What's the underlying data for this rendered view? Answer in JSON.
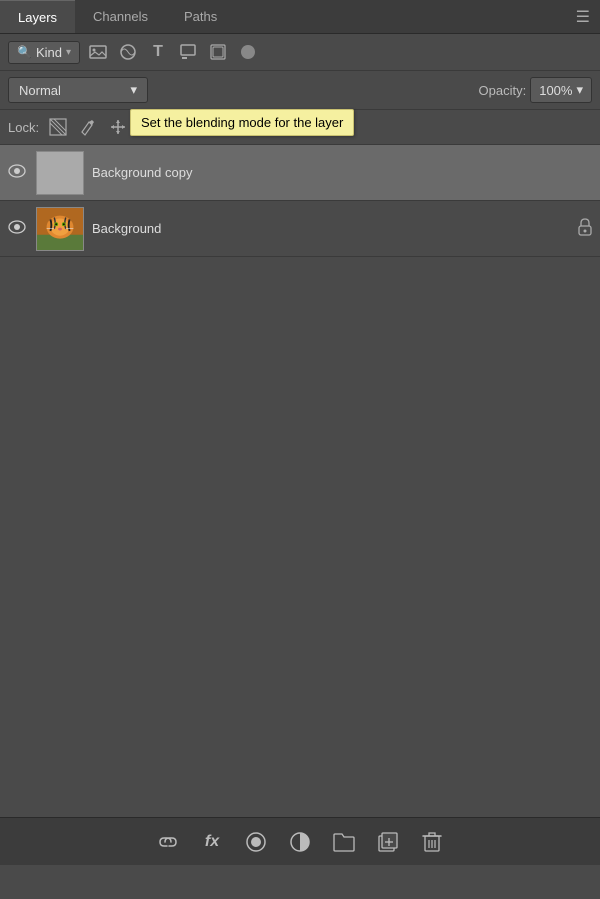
{
  "tabs": [
    {
      "id": "layers",
      "label": "Layers",
      "active": true
    },
    {
      "id": "channels",
      "label": "Channels",
      "active": false
    },
    {
      "id": "paths",
      "label": "Paths",
      "active": false
    }
  ],
  "filter": {
    "kind_label": "Kind",
    "icons": [
      {
        "name": "image-icon",
        "symbol": "🖼",
        "active": false
      },
      {
        "name": "circle-icon",
        "symbol": "◑",
        "active": false
      },
      {
        "name": "type-icon",
        "symbol": "T",
        "active": false
      },
      {
        "name": "crop-icon",
        "symbol": "⌗",
        "active": false
      },
      {
        "name": "stamp-icon",
        "symbol": "⬡",
        "active": false
      },
      {
        "name": "circle-dot-icon",
        "symbol": "⬤",
        "active": false
      }
    ]
  },
  "blend": {
    "mode": "Normal",
    "mode_arrow": "▾",
    "opacity_label": "Opacity:",
    "opacity_value": "100%",
    "opacity_arrow": "▾"
  },
  "tooltip": {
    "text": "Set the blending mode for the layer"
  },
  "lock": {
    "label": "Lock:",
    "icons": [
      {
        "name": "lock-pixels-icon",
        "symbol": "⬚"
      },
      {
        "name": "lock-paint-icon",
        "symbol": "✏"
      },
      {
        "name": "lock-move-icon",
        "symbol": "✛"
      },
      {
        "name": "lock-artboard-icon",
        "symbol": "⬜"
      }
    ]
  },
  "layers": [
    {
      "id": "background-copy",
      "name": "Background copy",
      "visible": true,
      "selected": true,
      "thumb_type": "grey",
      "locked": false
    },
    {
      "id": "background",
      "name": "Background",
      "visible": true,
      "selected": false,
      "thumb_type": "tiger",
      "locked": true
    }
  ],
  "bottom_toolbar": {
    "icons": [
      {
        "name": "link-icon",
        "symbol": "⛓"
      },
      {
        "name": "fx-icon",
        "symbol": "fx"
      },
      {
        "name": "mask-icon",
        "symbol": "◎"
      },
      {
        "name": "adjustment-icon",
        "symbol": "◑"
      },
      {
        "name": "folder-icon",
        "symbol": "▭"
      },
      {
        "name": "new-layer-icon",
        "symbol": "⬜"
      },
      {
        "name": "delete-icon",
        "symbol": "🗑"
      }
    ]
  },
  "colors": {
    "bg": "#4a4a4a",
    "tab_bar": "#3c3c3c",
    "selected_layer": "#6a6a6a",
    "tooltip_bg": "#f5f0a0"
  }
}
